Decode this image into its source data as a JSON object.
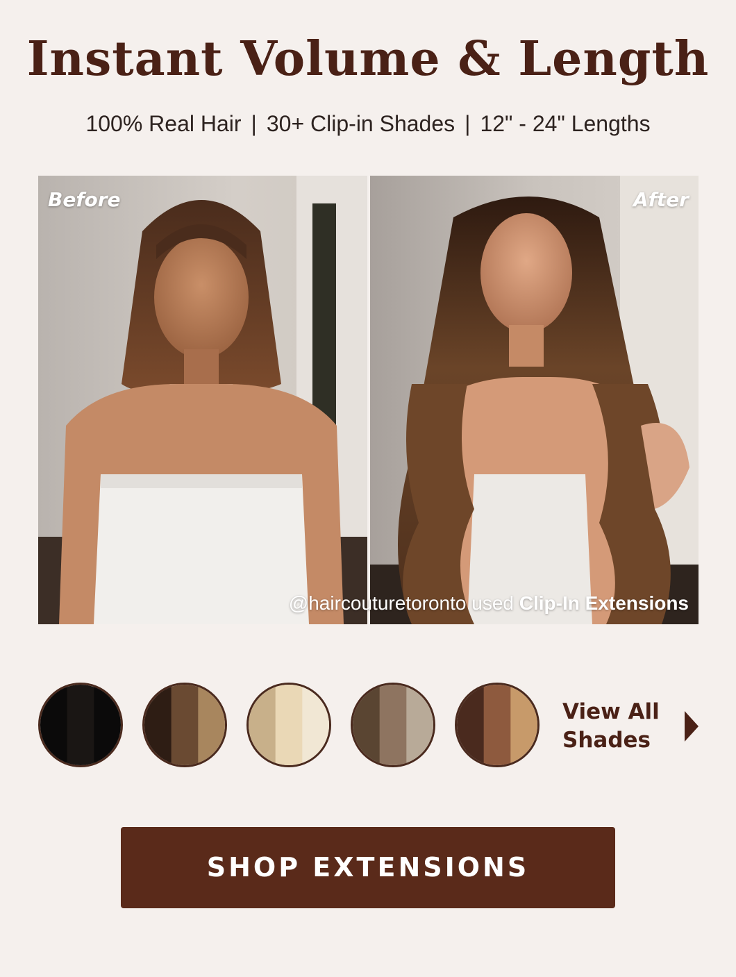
{
  "header": {
    "title": "Instant Volume & Length",
    "features": [
      "100% Real Hair",
      "30+ Clip-in Shades",
      "12\" - 24\" Lengths"
    ],
    "separator": "|"
  },
  "comparison": {
    "before_label": "Before",
    "after_label": "After",
    "credit_handle": "@haircouturetoronto",
    "credit_middle": " used ",
    "credit_product": "Clip-In Extensions"
  },
  "shades": {
    "swatches": [
      {
        "name": "black-shade",
        "colors": [
          "#0b0a0a",
          "#1a1614",
          "#0b0a0a"
        ]
      },
      {
        "name": "brown-shade",
        "colors": [
          "#2e1d14",
          "#6a4a32",
          "#a8865e"
        ]
      },
      {
        "name": "blonde-shade",
        "colors": [
          "#c8b08a",
          "#ead8b6",
          "#f1e7d4"
        ]
      },
      {
        "name": "ash-brown-shade",
        "colors": [
          "#5a4532",
          "#8e7460",
          "#b8aa98"
        ]
      },
      {
        "name": "chestnut-shade",
        "colors": [
          "#4a2a1e",
          "#8e5a3e",
          "#c79a6a"
        ]
      }
    ],
    "view_all_label": "View All Shades"
  },
  "cta": {
    "label": "SHOP EXTENSIONS"
  },
  "colors": {
    "background": "#f5f0ed",
    "brand_brown": "#5a2a1a",
    "heading": "#4a2116"
  }
}
